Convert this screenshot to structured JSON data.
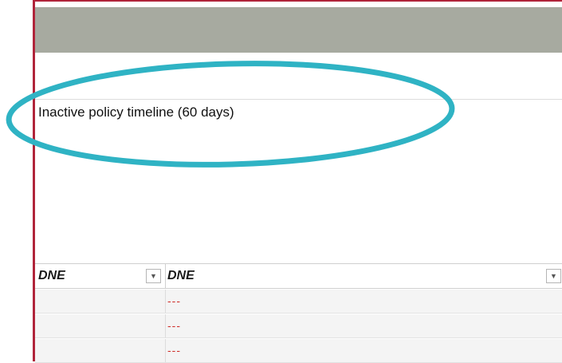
{
  "panel": {
    "title": "Inactive policy timeline (60 days)"
  },
  "table": {
    "columns": [
      {
        "label": "DNE"
      },
      {
        "label": "DNE"
      }
    ],
    "rows": [
      {
        "col1": "",
        "col2": "---"
      },
      {
        "col1": "",
        "col2": "---"
      },
      {
        "col1": "",
        "col2": "---"
      }
    ]
  },
  "colors": {
    "accent_border": "#b0243a",
    "header_bar": "#a7aaa0",
    "annotation_ellipse": "#2fb3c4",
    "dash_text": "#d0312d"
  },
  "icons": {
    "filter": "chevron-down-icon"
  }
}
